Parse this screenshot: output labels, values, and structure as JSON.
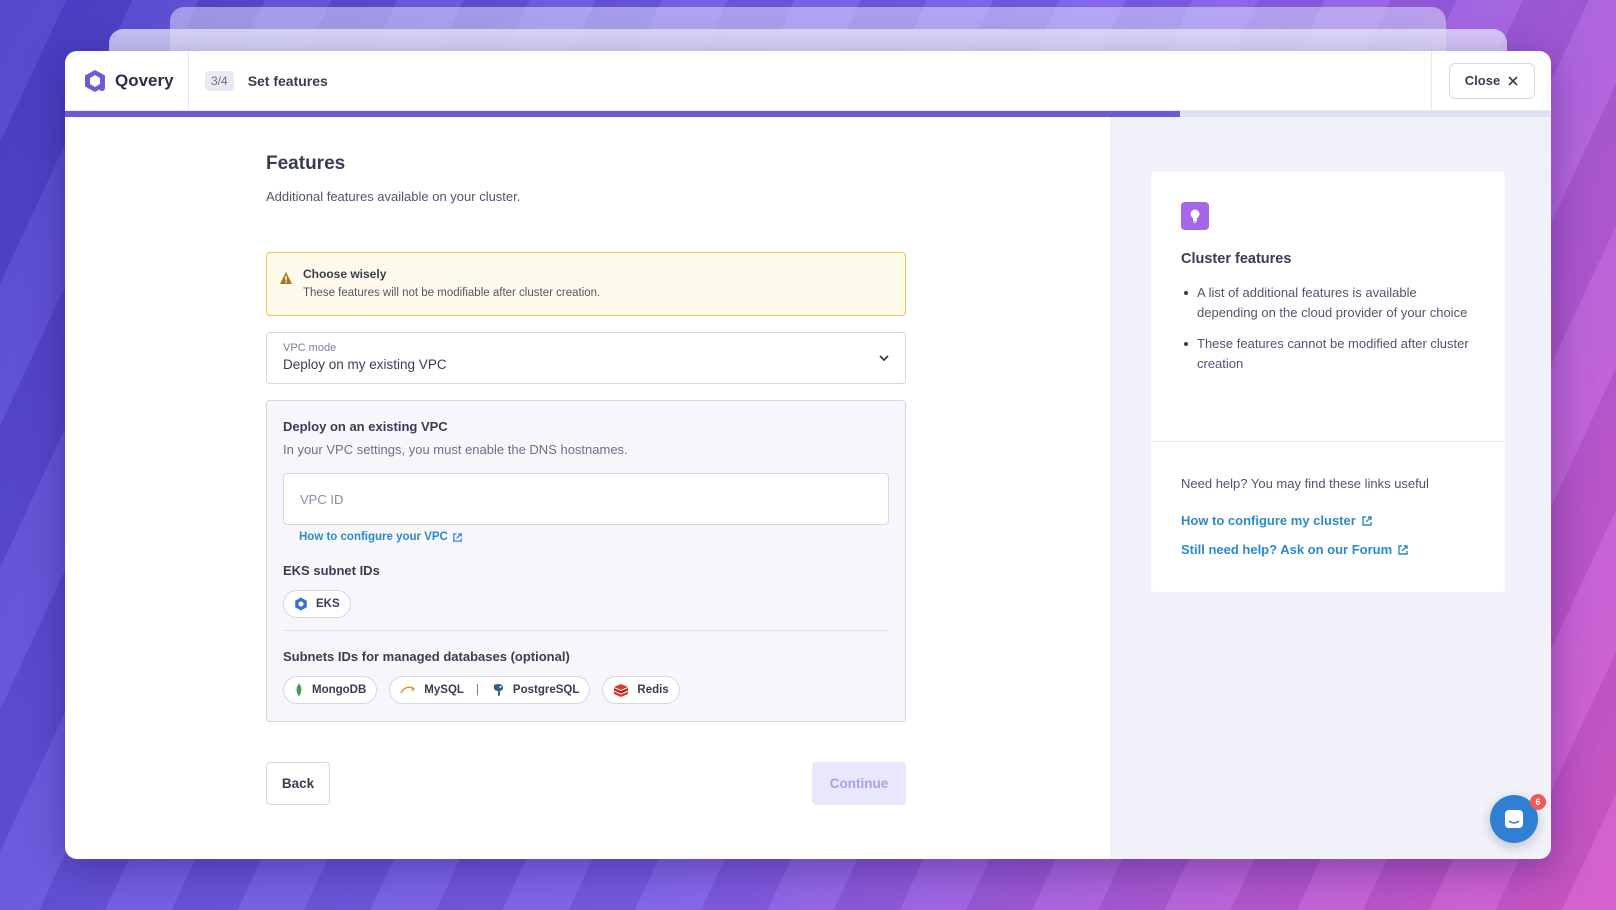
{
  "app": {
    "name": "Qovery"
  },
  "header": {
    "step_badge": "3/4",
    "step_title": "Set features",
    "close_label": "Close"
  },
  "progress": {
    "fraction": 0.75
  },
  "main": {
    "title": "Features",
    "subtitle": "Additional features available on your cluster.",
    "callout": {
      "title": "Choose wisely",
      "description": "These features will not be modifiable after cluster creation."
    },
    "vpc_select": {
      "label": "VPC mode",
      "value": "Deploy on my existing VPC"
    },
    "vpc_box": {
      "title": "Deploy on an existing VPC",
      "description": "In your VPC settings, you must enable the DNS hostnames.",
      "input_placeholder": "VPC ID",
      "help_link": "How to configure your VPC",
      "eks_title": "EKS subnet IDs",
      "eks_tag": "EKS",
      "db_title": "Subnets IDs for managed databases (optional)",
      "db_tags": {
        "mongodb": "MongoDB",
        "mysql": "MySQL",
        "separator": "|",
        "postgresql": "PostgreSQL",
        "redis": "Redis"
      }
    },
    "actions": {
      "back": "Back",
      "continue": "Continue"
    }
  },
  "aside": {
    "title": "Cluster features",
    "items": [
      "A list of additional features is available depending on the cloud provider of your choice",
      "These features cannot be modified after cluster creation"
    ],
    "help_text": "Need help? You may find these links useful",
    "links": [
      "How to configure my cluster",
      "Still need help? Ask on our Forum"
    ]
  },
  "chat": {
    "badge_count": "6"
  },
  "colors": {
    "accent": "#6c5bd6",
    "link": "#2d8ac8",
    "warning_border": "#f0c34a",
    "warning_bg": "#fefaec",
    "bulb": "#a566e8",
    "chat": "#2f7fd4",
    "badge": "#f25a5a"
  },
  "icons": [
    "qovery-logo-icon",
    "close-icon",
    "warning-icon",
    "chevron-down-icon",
    "external-link-icon",
    "eks-icon",
    "mongodb-icon",
    "mysql-icon",
    "postgresql-icon",
    "redis-icon",
    "lightbulb-icon",
    "chat-icon"
  ]
}
